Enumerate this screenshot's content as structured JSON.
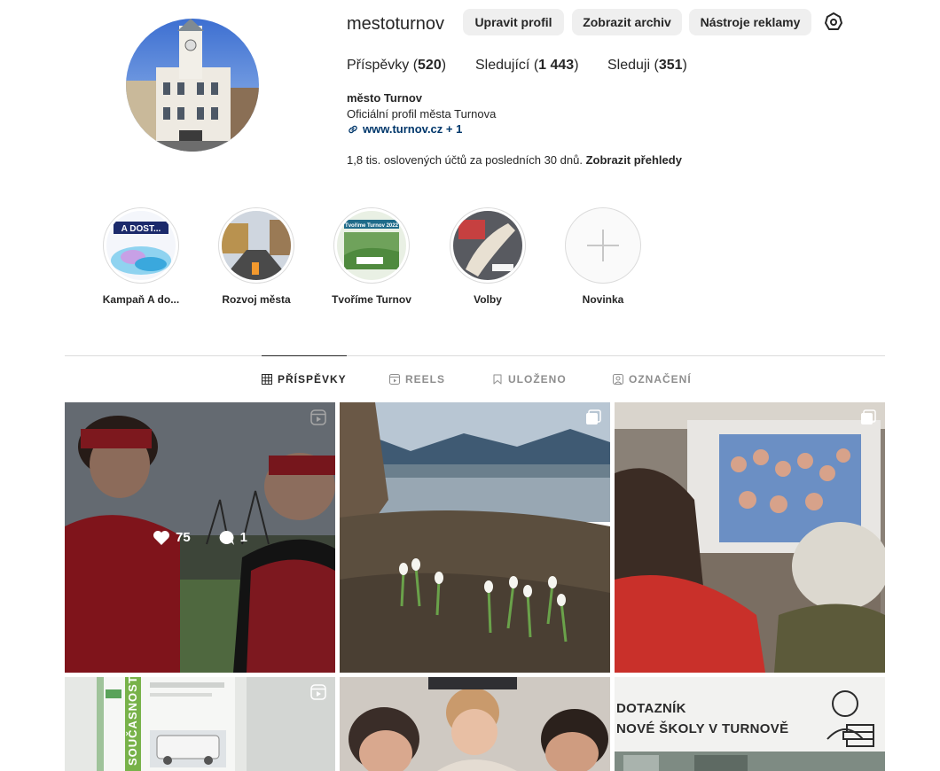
{
  "profile": {
    "username": "mestoturnov",
    "full_name": "město Turnov",
    "bio": "Oficiální profil města Turnova",
    "link": "www.turnov.cz + 1",
    "reach_text": "1,8 tis. oslovených účtů za posledních 30 dnů.",
    "reach_link": "Zobrazit přehledy"
  },
  "buttons": {
    "edit": "Upravit profil",
    "archive": "Zobrazit archiv",
    "ads": "Nástroje reklamy"
  },
  "stats": {
    "posts_label": "Příspěvky",
    "posts_count": "520",
    "followers_label": "Sledující",
    "followers_count": "1 443",
    "following_label": "Sleduji",
    "following_count": "351"
  },
  "highlights": [
    {
      "label": "Kampaň A do...",
      "cover_text": "A DOST..."
    },
    {
      "label": "Rozvoj města"
    },
    {
      "label": "Tvoříme Turnov",
      "cover_text": "Tvoříme Turnov 2022"
    },
    {
      "label": "Volby"
    },
    {
      "label": "Novinka"
    }
  ],
  "tabs": [
    {
      "label": "PŘÍSPĚVKY",
      "active": true
    },
    {
      "label": "REELS",
      "active": false
    },
    {
      "label": "ULOŽENO",
      "active": false
    },
    {
      "label": "OZNAČENÍ",
      "active": false
    }
  ],
  "posts": [
    {
      "type": "reel",
      "likes": "75",
      "comments": "1"
    },
    {
      "type": "carousel"
    },
    {
      "type": "carousel"
    },
    {
      "type": "reel",
      "poster_text": "SOUČASNOST"
    },
    {
      "type": "image"
    },
    {
      "type": "image",
      "title_line1": "DOTAZNÍK",
      "title_line2": "NOVÉ ŠKOLY V TURNOVĚ"
    }
  ]
}
